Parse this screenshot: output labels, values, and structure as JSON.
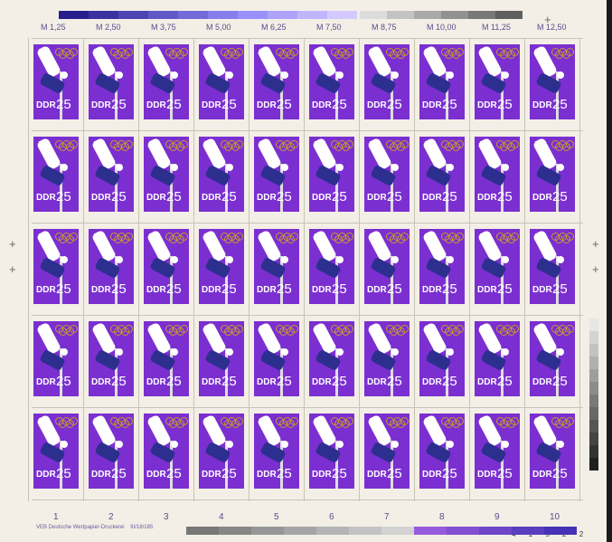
{
  "sheet": {
    "value_labels": [
      "M 1,25",
      "M 2,50",
      "M 3,75",
      "M 5,00",
      "M 6,25",
      "M 7,50",
      "M 8,75",
      "M 10,00",
      "M 11,25",
      "M 12,50"
    ],
    "column_numbers": [
      "1",
      "2",
      "3",
      "4",
      "5",
      "6",
      "7",
      "8",
      "9",
      "10"
    ],
    "printer_text": "VEB Deutsche Wertpapier-Druckerei",
    "printer_code": "III/18/185",
    "bottom_numbers": "4 1 5 2 2",
    "stamp_country": "DDR",
    "stamp_value": "25",
    "rows": 5,
    "columns": 10,
    "colors": {
      "stamp_bg": "#7b2fd0",
      "paper": "#f3efe6",
      "label_ink": "#5a4c8c"
    }
  }
}
